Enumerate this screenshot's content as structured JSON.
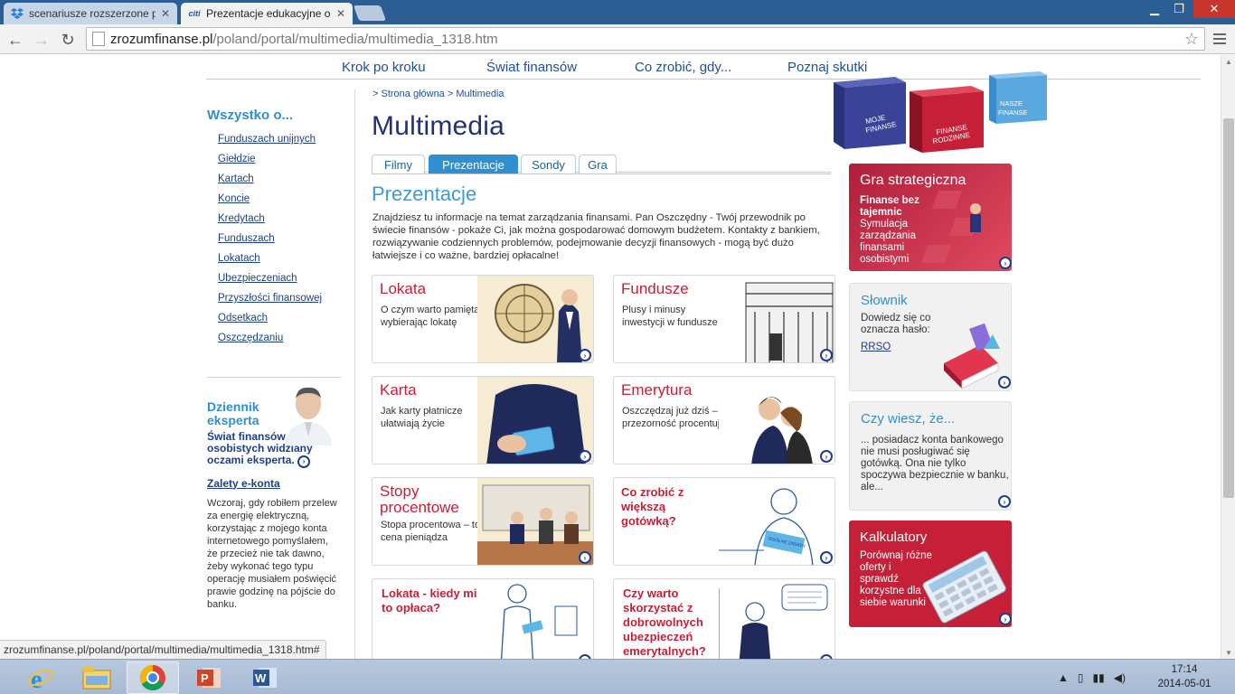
{
  "browser": {
    "tabs": [
      {
        "title": "scenariusze rozszerzone pl",
        "active": false,
        "icon": "dropbox-icon"
      },
      {
        "title": "Prezentacje edukacyjne o",
        "active": true,
        "icon": "citi-icon"
      }
    ],
    "url_host": "zrozumfinanse.pl",
    "url_path": "/poland/portal/multimedia/multimedia_1318.htm",
    "status_url": "zrozumfinanse.pl/poland/portal/multimedia/multimedia_1318.htm#"
  },
  "site": {
    "topnav": [
      "Krok po kroku",
      "Świat finansów",
      "Co zrobić, gdy...",
      "Poznaj skutki"
    ],
    "cubes": [
      "MOJE FINANSE",
      "FINANSE RODZINNE",
      "NASZE FINANSE"
    ],
    "sidebar": {
      "title": "Wszystko o...",
      "items": [
        "Funduszach unijnych",
        "Giełdzie",
        "Kartach",
        "Koncie",
        "Kredytach",
        "Funduszach",
        "Lokatach",
        "Ubezpieczeniach",
        "Przyszłości finansowej",
        "Odsetkach",
        "Oszczędzaniu"
      ]
    },
    "expert": {
      "title": "Dziennik eksperta",
      "subtitle": "Świat finansów osobistych widziany oczami eksperta.",
      "link": "Zalety e-konta",
      "text": "Wczoraj, gdy robiłem przelew za energię elektryczną, korzystając z mojego konta internetowego pomyślałem, że przecież nie tak dawno, żeby wykonać tego typu operację musiałem poświęcić prawie godzinę na pójście do banku."
    },
    "breadcrumb": "> Strona główna > Multimedia",
    "page_title": "Multimedia",
    "content_tabs": [
      "Filmy",
      "Prezentacje",
      "Sondy",
      "Gra"
    ],
    "active_tab": "Prezentacje",
    "section_title": "Prezentacje",
    "intro": "Znajdziesz tu informacje na temat zarządzania finansami. Pan Oszczędny - Twój przewodnik po świecie finansów - pokaże Ci, jak można gospodarować domowym budżetem. Kontakty z bankiem, rozwiązywanie codziennych problemów, podejmowanie decyzji finansowych - mogą być dużo łatwiejsze i co ważne, bardziej opłacalne!",
    "cards": [
      {
        "title": "Lokata",
        "desc": "O czym warto pamiętać wybierając lokatę"
      },
      {
        "title": "Fundusze",
        "desc": "Plusy i minusy inwestycji w fundusze"
      },
      {
        "title": "Karta",
        "desc": "Jak karty płatnicze ułatwiają życie"
      },
      {
        "title": "Emerytura",
        "desc": "Oszczędzaj już dziś – przezorność procentuje"
      },
      {
        "title": "Stopy procentowe",
        "desc": "Stopa procentowa – to cena pieniądza"
      },
      {
        "title": "Co zrobić z większą gotówką?",
        "desc": ""
      },
      {
        "title": "Lokata - kiedy mi się to opłaca?",
        "desc": ""
      },
      {
        "title": "Czy warto skorzystać z dobrowolnych ubezpieczeń emerytalnych?",
        "desc": ""
      }
    ],
    "card_image_text": "OGÓLNE ZASADY",
    "right": {
      "game": {
        "title": "Gra strategiczna",
        "subtitle": "Finanse bez tajemnic",
        "text": "Symulacja zarządzania finansami osobistymi"
      },
      "glossary": {
        "title": "Słownik",
        "text": "Dowiedz się co oznacza hasło:",
        "link": "RRSO"
      },
      "didyouknow": {
        "title": "Czy wiesz, że...",
        "text": "... posiadacz konta bankowego nie musi posługiwać się gotówką. Ona nie tylko spoczywa bezpiecznie w banku, ale..."
      },
      "calc": {
        "title": "Kalkulatory",
        "text": "Porównaj różne oferty i sprawdź korzystne dla siebie warunki"
      }
    }
  },
  "taskbar": {
    "apps": [
      "internet-explorer-icon",
      "file-explorer-icon",
      "chrome-icon",
      "powerpoint-icon",
      "word-icon"
    ],
    "time": "17:14",
    "date": "2014-05-01"
  },
  "colors": {
    "brand_blue": "#1d4f9c",
    "accent_red": "#c52038",
    "accent_cyan": "#2f8fd0",
    "titlebar": "#2c5d93"
  }
}
